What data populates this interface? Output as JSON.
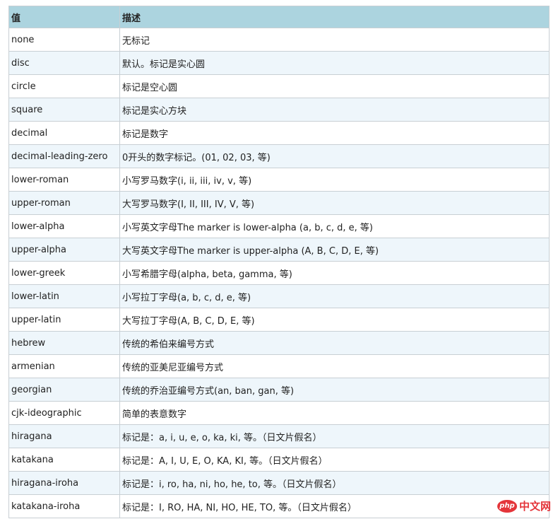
{
  "header": {
    "value": "值",
    "description": "描述"
  },
  "rows": [
    {
      "value": "none",
      "description": "无标记"
    },
    {
      "value": "disc",
      "description": "默认。标记是实心圆"
    },
    {
      "value": "circle",
      "description": "标记是空心圆"
    },
    {
      "value": "square",
      "description": "标记是实心方块"
    },
    {
      "value": "decimal",
      "description": "标记是数字"
    },
    {
      "value": "decimal-leading-zero",
      "description": "0开头的数字标记。(01, 02, 03, 等)"
    },
    {
      "value": "lower-roman",
      "description": "小写罗马数字(i, ii, iii, iv, v, 等)"
    },
    {
      "value": "upper-roman",
      "description": "大写罗马数字(I, II, III, IV, V, 等)"
    },
    {
      "value": "lower-alpha",
      "description": "小写英文字母The marker is lower-alpha (a, b, c, d, e, 等)"
    },
    {
      "value": "upper-alpha",
      "description": "大写英文字母The marker is upper-alpha (A, B, C, D, E, 等)"
    },
    {
      "value": "lower-greek",
      "description": "小写希腊字母(alpha, beta, gamma, 等)"
    },
    {
      "value": "lower-latin",
      "description": "小写拉丁字母(a, b, c, d, e, 等)"
    },
    {
      "value": "upper-latin",
      "description": "大写拉丁字母(A, B, C, D, E, 等)"
    },
    {
      "value": "hebrew",
      "description": "传统的希伯来编号方式"
    },
    {
      "value": "armenian",
      "description": "传统的亚美尼亚编号方式"
    },
    {
      "value": "georgian",
      "description": "传统的乔治亚编号方式(an, ban, gan, 等)"
    },
    {
      "value": "cjk-ideographic",
      "description": "简单的表意数字"
    },
    {
      "value": "hiragana",
      "description": "标记是：a, i, u, e, o, ka, ki, 等。（日文片假名）"
    },
    {
      "value": "katakana",
      "description": "标记是：A, I, U, E, O, KA, KI, 等。（日文片假名）"
    },
    {
      "value": "hiragana-iroha",
      "description": "标记是：i, ro, ha, ni, ho, he, to, 等。（日文片假名）"
    },
    {
      "value": "katakana-iroha",
      "description": "标记是：I, RO, HA, NI, HO, HE, TO, 等。（日文片假名）"
    }
  ],
  "watermark": {
    "logo": "php",
    "text": "中文网"
  },
  "colors": {
    "header_bg": "#acd4df",
    "stripe_bg": "#eef6fb",
    "border": "#c8cfd4",
    "brand_red": "#e2242a"
  }
}
